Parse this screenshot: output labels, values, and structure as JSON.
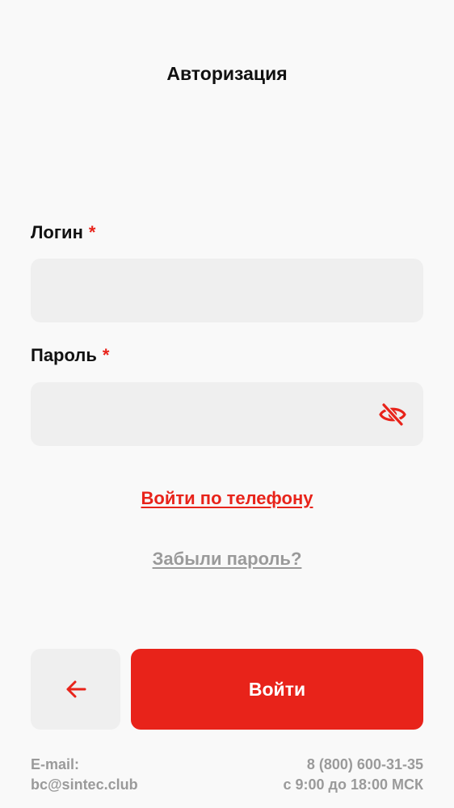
{
  "header": {
    "title": "Авторизация"
  },
  "form": {
    "login": {
      "label": "Логин",
      "required_mark": "*",
      "value": "",
      "placeholder": ""
    },
    "password": {
      "label": "Пароль",
      "required_mark": "*",
      "value": "",
      "placeholder": "",
      "toggle_icon": "eye-off-icon"
    }
  },
  "links": {
    "phone_login": "Войти по телефону",
    "forgot_password": "Забыли пароль?"
  },
  "actions": {
    "back_icon": "arrow-left-icon",
    "login_label": "Войти"
  },
  "footer": {
    "email_label": "E-mail:",
    "email_value": "bc@sintec.club",
    "phone": "8 (800) 600-31-35",
    "hours": "с 9:00 до 18:00 МСК"
  },
  "colors": {
    "accent": "#e8231a",
    "background": "#f9f9f9",
    "input_background": "#efefef",
    "muted_text": "#9a9a9a"
  }
}
